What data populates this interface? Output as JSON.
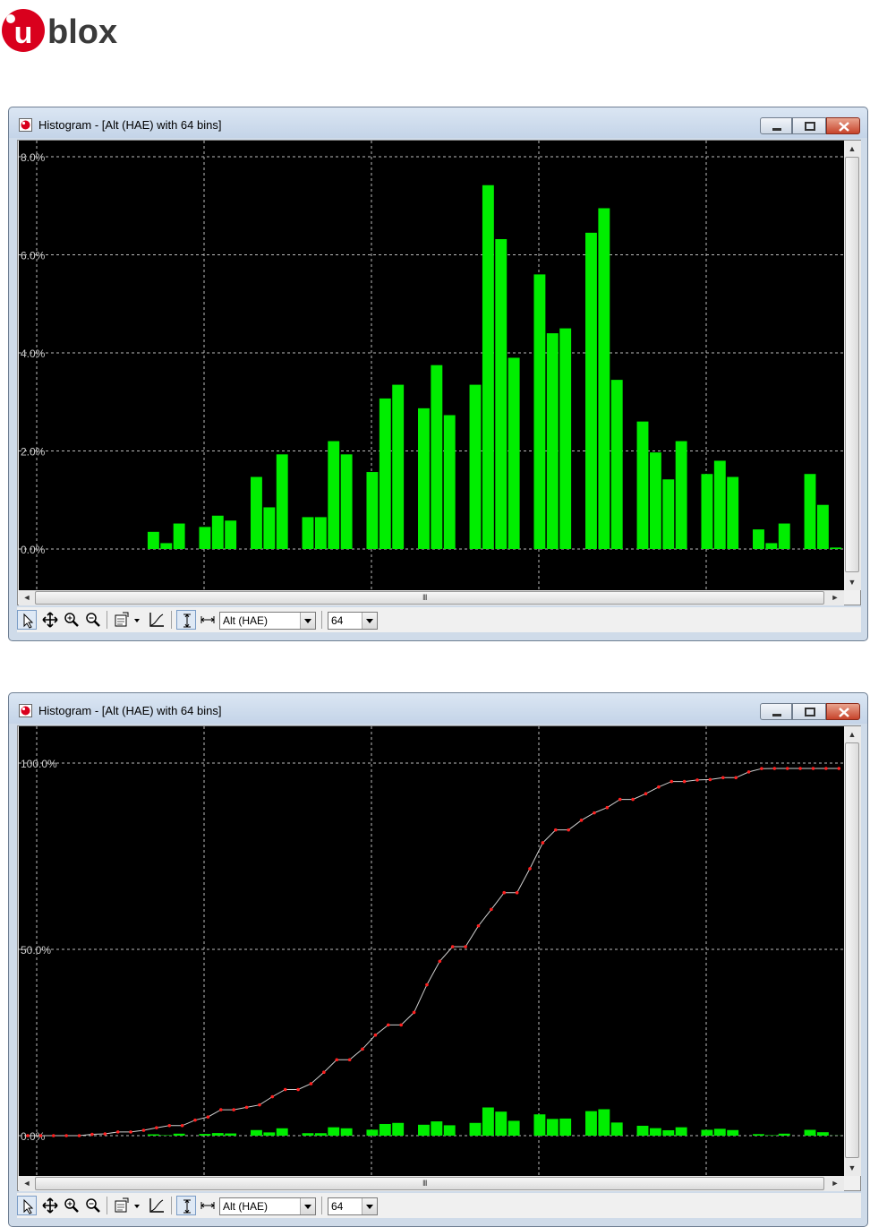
{
  "brand": {
    "logo_u": "u",
    "logo_rest": "blox",
    "color": "#d9001d"
  },
  "windows": [
    {
      "title": "Histogram - [Alt (HAE) with 64 bins]",
      "view": "histogram",
      "toolbar": {
        "field": "Alt (HAE)",
        "bins": "64"
      },
      "scroll_grip": "III",
      "chart_data": {
        "type": "bar",
        "y_tick_labels": [
          "0.0%",
          "2.0%",
          "4.0%",
          "6.0%",
          "8.0%"
        ],
        "ylim": [
          0,
          8.0
        ],
        "grid": true,
        "bar_color": "#00ee00",
        "values": [
          0,
          0,
          0,
          0,
          0,
          0.35,
          0.12,
          0.52,
          0,
          0.45,
          0.68,
          0.58,
          0,
          1.47,
          0.85,
          1.93,
          0,
          0.65,
          0.65,
          2.2,
          1.93,
          0,
          1.57,
          3.07,
          3.35,
          0,
          2.87,
          3.75,
          2.73,
          0,
          3.35,
          7.42,
          6.32,
          3.9,
          0,
          5.6,
          4.4,
          4.5,
          0,
          6.45,
          6.95,
          3.45,
          0,
          2.6,
          1.97,
          1.42,
          2.2,
          0,
          1.53,
          1.8,
          1.47,
          0,
          0.4,
          0.12,
          0.52,
          0,
          1.53,
          0.9,
          0.03,
          0,
          0,
          0,
          0,
          0
        ]
      }
    },
    {
      "title": "Histogram - [Alt (HAE) with 64 bins]",
      "view": "cumulative",
      "toolbar": {
        "field": "Alt (HAE)",
        "bins": "64"
      },
      "scroll_grip": "III",
      "chart_data": {
        "type": "line",
        "y_tick_labels": [
          "0.0%",
          "50.0%",
          "100.0%"
        ],
        "ylim": [
          0,
          100.0
        ],
        "grid": true,
        "line_color": "#d0d0d0",
        "marker_color": "#ff2020",
        "bar_color": "#00ee00",
        "cumulative": [
          0,
          0,
          0,
          0,
          0,
          0.35,
          0.47,
          0.99,
          0.99,
          1.44,
          2.12,
          2.7,
          2.7,
          4.17,
          5.02,
          6.95,
          6.95,
          7.6,
          8.25,
          10.45,
          12.38,
          12.38,
          13.95,
          17.02,
          20.37,
          20.37,
          23.24,
          26.99,
          29.72,
          29.72,
          33.07,
          40.49,
          46.81,
          50.71,
          50.71,
          56.31,
          60.71,
          65.21,
          65.21,
          71.66,
          78.61,
          82.06,
          82.06,
          84.66,
          86.63,
          88.05,
          90.25,
          90.25,
          91.78,
          93.58,
          95.05,
          95.05,
          95.45,
          95.57,
          96.09,
          96.09,
          97.62,
          98.52,
          98.55,
          98.55,
          98.55,
          98.55,
          98.55,
          98.55
        ],
        "values": [
          0,
          0,
          0,
          0,
          0,
          0.35,
          0.12,
          0.52,
          0,
          0.45,
          0.68,
          0.58,
          0,
          1.47,
          0.85,
          1.93,
          0,
          0.65,
          0.65,
          2.2,
          1.93,
          0,
          1.57,
          3.07,
          3.35,
          0,
          2.87,
          3.75,
          2.73,
          0,
          3.35,
          7.42,
          6.32,
          3.9,
          0,
          5.6,
          4.4,
          4.5,
          0,
          6.45,
          6.95,
          3.45,
          0,
          2.6,
          1.97,
          1.42,
          2.2,
          0,
          1.53,
          1.8,
          1.47,
          0,
          0.4,
          0.12,
          0.52,
          0,
          1.53,
          0.9,
          0.03,
          0,
          0,
          0,
          0,
          0
        ]
      }
    }
  ]
}
